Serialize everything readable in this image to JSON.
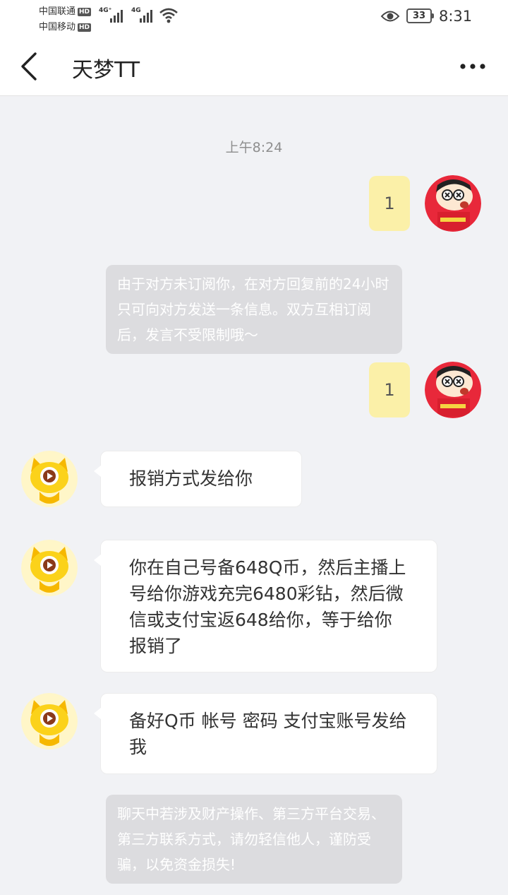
{
  "status": {
    "carrier1": "中国联通",
    "carrier2": "中国移动",
    "hd": "HD",
    "net1": "4G⁺",
    "net2": "4G",
    "battery": "33",
    "time": "8:31"
  },
  "header": {
    "title": "天梦TT",
    "back_icon": "chevron-left-icon",
    "more_icon": "more-dots-icon"
  },
  "chat": {
    "timestamp": "上午8:24",
    "messages": [
      {
        "side": "out",
        "text": "1"
      },
      {
        "side": "system",
        "text": "由于对方未订阅你，在对方回复前的24小时只可向对方发送一条信息。双方互相订阅后，发言不受限制哦～"
      },
      {
        "side": "out",
        "text": "1"
      },
      {
        "side": "in",
        "text": "报销方式发给你"
      },
      {
        "side": "in",
        "text": "你在自己号备648Q币，然后主播上号给你游戏充完6480彩钻，然后微信或支付宝返648给你，等于给你报销了"
      },
      {
        "side": "in",
        "text": "备好Q币 帐号 密码 支付宝账号发给我"
      },
      {
        "side": "system",
        "text": "聊天中若涉及财产操作、第三方平台交易、第三方联系方式，请勿轻信他人，谨防受骗，以免资金损失!"
      }
    ]
  },
  "colors": {
    "outgoing_bubble": "#fbf0a8",
    "system_bubble": "#dcdcdf",
    "background": "#f1f2f5"
  }
}
